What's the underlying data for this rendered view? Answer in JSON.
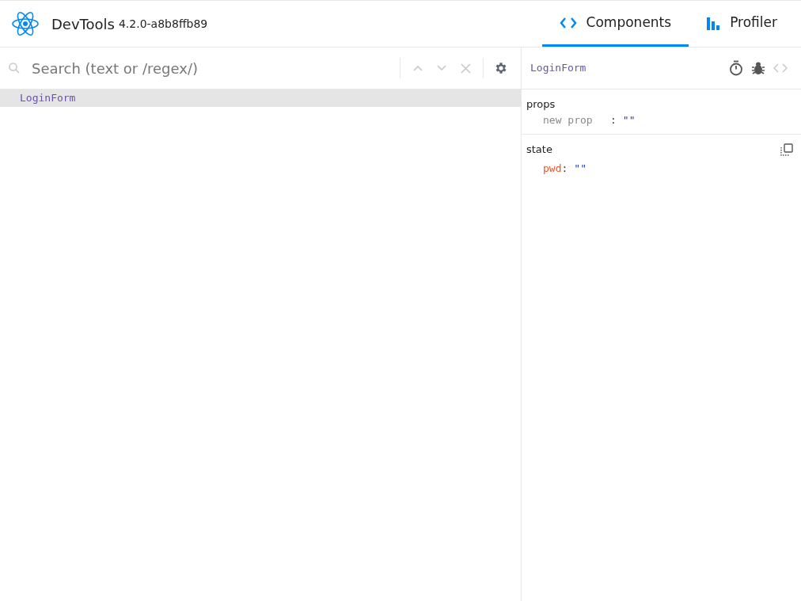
{
  "header": {
    "title": "DevTools",
    "version": "4.2.0-a8b8ffb89"
  },
  "tabs": [
    {
      "kind": "components",
      "label": "Components",
      "selected": true
    },
    {
      "kind": "profiler",
      "label": "Profiler",
      "selected": false
    }
  ],
  "search": {
    "placeholder": "Search (text or /regex/)",
    "prev_disabled": true,
    "next_disabled": true,
    "clear_disabled": true
  },
  "tree": [
    {
      "name": "LoginForm",
      "selected": true
    }
  ],
  "inspector": {
    "component": "LoginForm",
    "view_source_disabled": true,
    "props": {
      "title": "props",
      "entries": [
        {
          "kind": "new",
          "name": "new prop",
          "separator": ":",
          "value": "\"\""
        }
      ]
    },
    "state": {
      "title": "state",
      "entries": [
        {
          "kind": "value",
          "name": "pwd",
          "separator": ":",
          "value": "\"\""
        }
      ]
    }
  }
}
